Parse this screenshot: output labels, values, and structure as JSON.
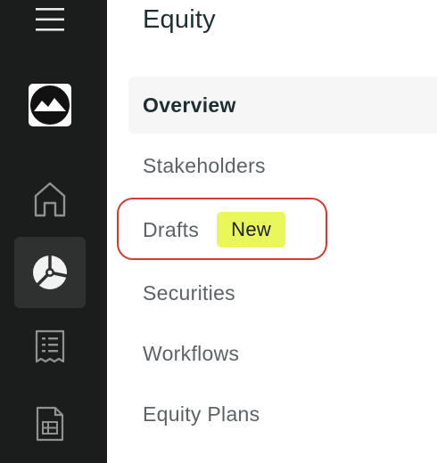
{
  "sidebar": {
    "items": [
      {
        "name": "menu",
        "icon": "hamburger-menu-icon"
      },
      {
        "name": "logo",
        "icon": "mountain-logo-icon"
      },
      {
        "name": "home",
        "icon": "home-icon"
      },
      {
        "name": "equity",
        "icon": "pie-chart-icon",
        "active": true
      },
      {
        "name": "ledger",
        "icon": "receipt-icon"
      },
      {
        "name": "documents",
        "icon": "document-table-icon"
      }
    ]
  },
  "panel": {
    "title": "Equity",
    "nav": [
      {
        "label": "Overview",
        "active": true
      },
      {
        "label": "Stakeholders"
      },
      {
        "label": "Drafts",
        "badge": "New",
        "highlighted": true
      },
      {
        "label": "Securities"
      },
      {
        "label": "Workflows"
      },
      {
        "label": "Equity Plans"
      }
    ]
  },
  "colors": {
    "sidebar_bg": "#1b1c1c",
    "active_bg": "#2f3131",
    "badge_bg": "#eaf75b",
    "highlight_ring": "#d33a30",
    "title_text": "#1d2f33",
    "nav_text": "#5c6366"
  }
}
